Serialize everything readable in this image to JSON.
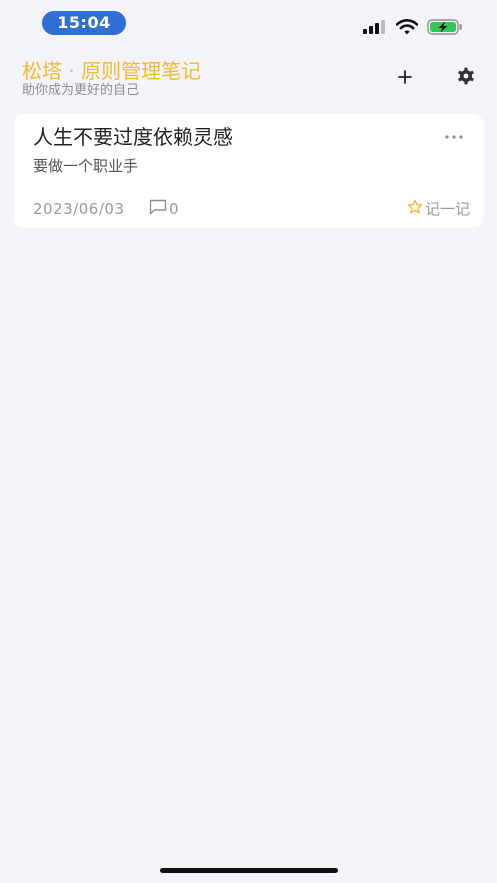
{
  "status_bar": {
    "time": "15:04",
    "icons": [
      "cellular-signal-icon",
      "wifi-icon",
      "battery-charging-icon"
    ]
  },
  "header": {
    "title": "松塔 · 原则管理笔记",
    "subtitle": "助你成为更好的自己",
    "actions": [
      "plus-icon",
      "gear-icon"
    ]
  },
  "notes": [
    {
      "title": "人生不要过度依赖灵感",
      "summary": "要做一个职业手",
      "date": "2023/06/03",
      "comment_count": "0",
      "record_label": "记一记"
    }
  ],
  "colors": {
    "accent": "#F0B932",
    "time_pill": "#2F6FD6",
    "background": "#F4F3F8",
    "card": "#FFFFFF",
    "muted_text": "#9A9A9E",
    "battery": "#34C759"
  }
}
